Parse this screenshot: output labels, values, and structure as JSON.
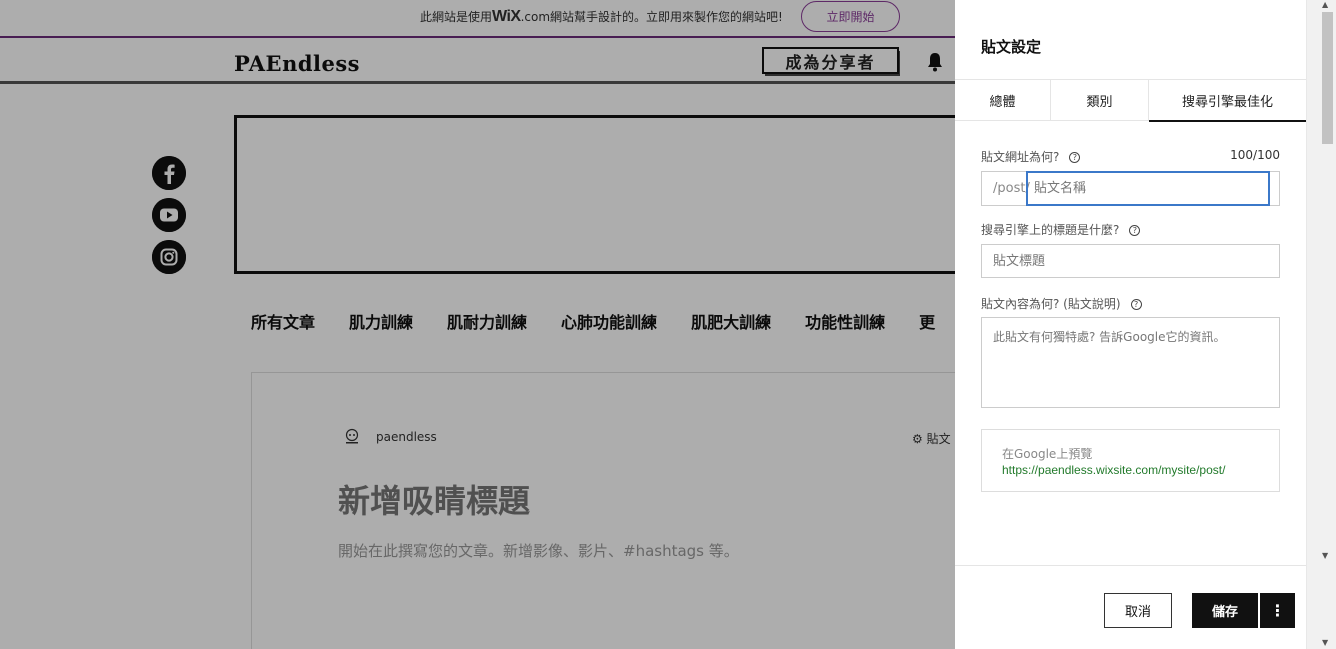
{
  "wix_banner": {
    "message_prefix": "此網站是使用",
    "brand": "WiX",
    "message_suffix": ".com網站幫手設計的。立即用來製作您的網站吧!",
    "cta_label": "立即開始"
  },
  "site": {
    "logo": "PAEndless",
    "share_button_label": "成為分享者",
    "social_icons": [
      "facebook-icon",
      "youtube-icon",
      "instagram-icon"
    ],
    "categories": [
      "所有文章",
      "肌力訓練",
      "肌耐力訓練",
      "心肺功能訓練",
      "肌肥大訓練",
      "功能性訓練",
      "更"
    ],
    "post": {
      "author": "paendless",
      "settings_label": "貼文",
      "title_placeholder": "新增吸睛標題",
      "body_placeholder": "開始在此撰寫您的文章。新增影像、影片、#hashtags 等。"
    }
  },
  "panel": {
    "title": "貼文設定",
    "tabs": [
      {
        "label": "總體",
        "active": false
      },
      {
        "label": "類別",
        "active": false
      },
      {
        "label": "搜尋引擎最佳化",
        "active": true
      }
    ],
    "url_field": {
      "label": "貼文網址為何?",
      "char_count": "100/100",
      "prefix": "/post/",
      "placeholder": "貼文名稱"
    },
    "seo_title_field": {
      "label": "搜尋引擎上的標題是什麼?",
      "placeholder": "貼文標題"
    },
    "description_field": {
      "label": "貼文內容為何? (貼文說明)",
      "placeholder": "此貼文有何獨特處? 告訴Google它的資訊。"
    },
    "google_preview": {
      "label": "在Google上預覽",
      "url": "https://paendless.wixsite.com/mysite/post/"
    },
    "cancel_label": "取消",
    "save_label": "儲存",
    "more_label": "⋮"
  },
  "colors": {
    "wix_accent": "#8b3d99",
    "focus_border": "#3b78c9",
    "preview_url": "#227a2b"
  }
}
